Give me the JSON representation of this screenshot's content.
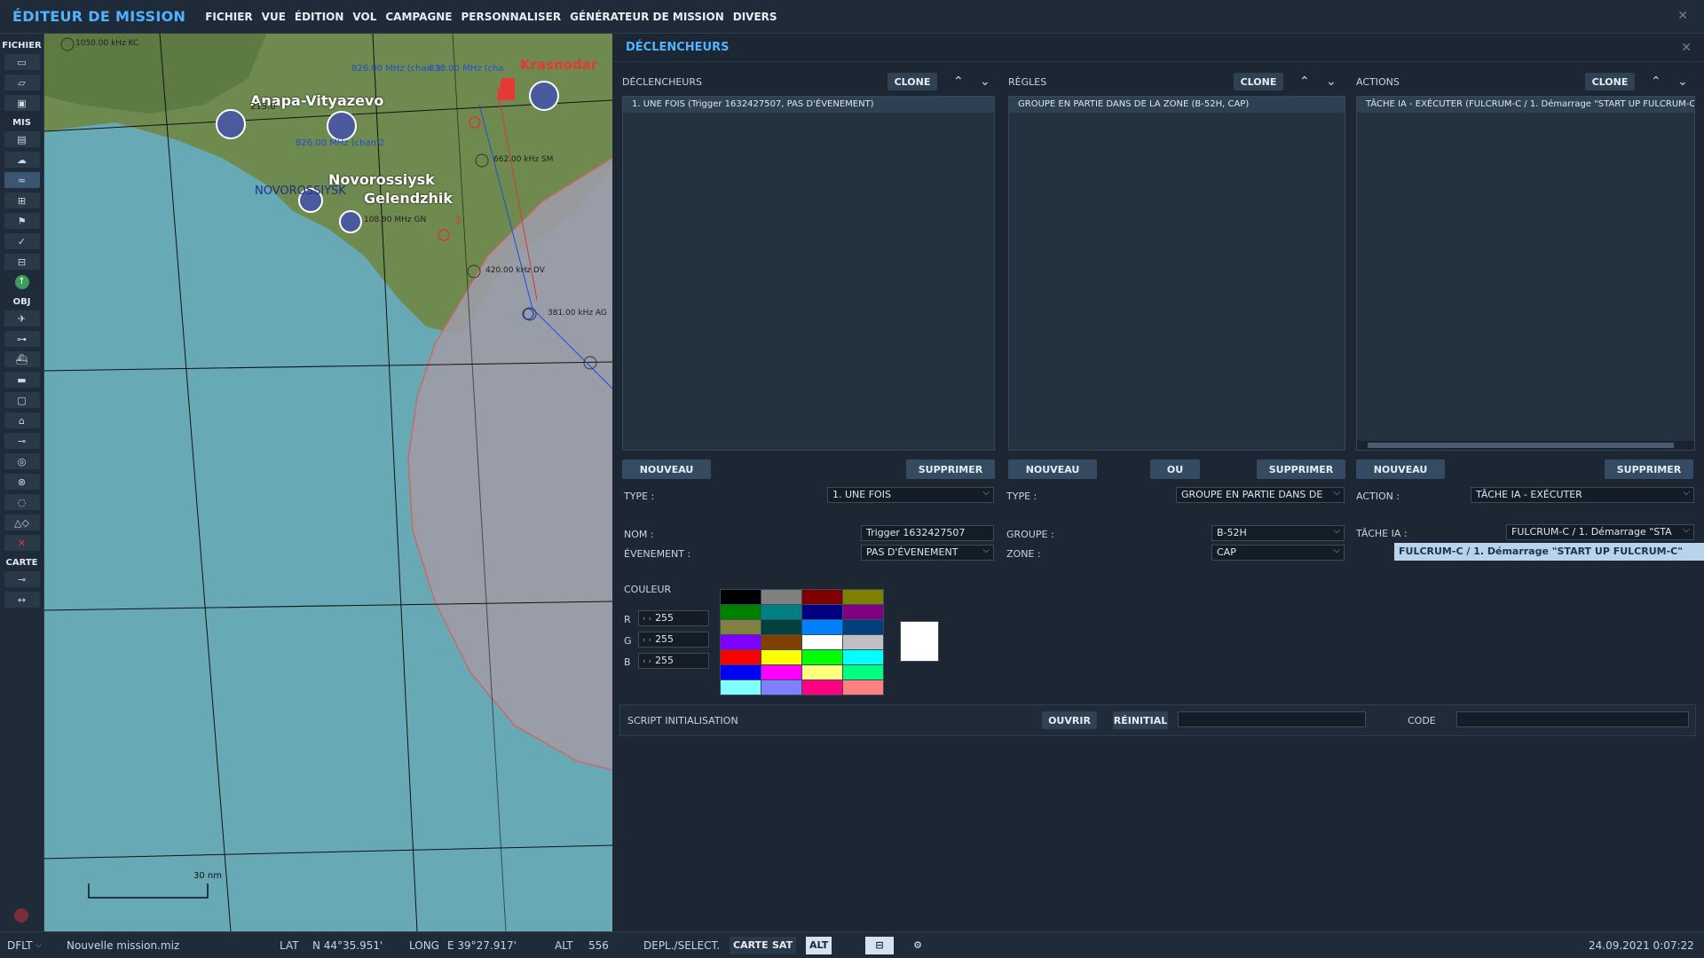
{
  "app": {
    "title": "ÉDITEUR DE MISSION"
  },
  "menu": [
    "FICHIER",
    "VUE",
    "ÉDITION",
    "VOL",
    "CAMPAGNE",
    "PERSONNALISER",
    "GÉNÉRATEUR DE MISSION",
    "DIVERS"
  ],
  "left_toolbar": {
    "fichier": "FICHIER",
    "mis": "MIS",
    "obj": "OBJ",
    "carte": "CARTE"
  },
  "map": {
    "labels": {
      "anapa": "Anapa-Vityazevo",
      "novorossiysk": "Novorossiysk",
      "novorossiysk_upper": "NOVOROSSIYSK",
      "gelendzhik": "Gelendzhik",
      "krasnodar": "Krasnodar"
    },
    "radio": [
      "1050.00 kHz KC",
      "826.00 MHz (chan 3",
      "215.0",
      "838.00 MHz (cha",
      "662.00 kHz SM",
      "420.00 kHz DV",
      "381.00 kHz AG",
      "826.00 MHz (chan 2",
      "108.90 MHz GN",
      "3"
    ],
    "scale": "30 nm"
  },
  "panel": {
    "title": "DÉCLENCHEURS",
    "triggers": {
      "title": "DÉCLENCHEURS",
      "clone": "CLONE",
      "items": [
        "1. UNE FOIS (Trigger 1632427507, PAS D'ÉVENEMENT)"
      ],
      "new": "NOUVEAU",
      "delete": "SUPPRIMER",
      "type_label": "TYPE :",
      "type_value": "1. UNE FOIS",
      "name_label": "NOM :",
      "name_value": "Trigger 1632427507",
      "event_label": "ÉVENEMENT :",
      "event_value": "PAS D'ÉVENEMENT",
      "color_label": "COULEUR",
      "r_label": "R",
      "r_value": "255",
      "g_label": "G",
      "g_value": "255",
      "b_label": "B",
      "b_value": "255"
    },
    "rules": {
      "title": "RÈGLES",
      "clone": "CLONE",
      "items": [
        "GROUPE EN PARTIE DANS DE LA ZONE (B-52H, CAP)"
      ],
      "new": "NOUVEAU",
      "or": "OU",
      "delete": "SUPPRIMER",
      "type_label": "TYPE :",
      "type_value": "GROUPE EN PARTIE DANS DE",
      "group_label": "GROUPE :",
      "group_value": "B-52H",
      "zone_label": "ZONE :",
      "zone_value": "CAP"
    },
    "actions": {
      "title": "ACTIONS",
      "clone": "CLONE",
      "items": [
        "TÂCHE IA - EXÉCUTER (FULCRUM-C / 1. Démarrage \"START UP FULCRUM-C"
      ],
      "new": "NOUVEAU",
      "delete": "SUPPRIMER",
      "action_label": "ACTION :",
      "action_value": "TÂCHE IA - EXÉCUTER",
      "task_label": "TÂCHE IA :",
      "task_value": "FULCRUM-C / 1. Démarrage \"STA",
      "tooltip": "FULCRUM-C / 1. Démarrage \"START UP FULCRUM-C\""
    },
    "script": {
      "label": "SCRIPT INITIALISATION",
      "open": "OUVRIR",
      "reset": "RÉINITIAL",
      "code_label": "CODE"
    },
    "palette": [
      "#000000",
      "#808080",
      "#800000",
      "#808000",
      "#008000",
      "#008080",
      "#000080",
      "#800080",
      "#808040",
      "#004040",
      "#0080ff",
      "#004080",
      "#8000ff",
      "#804000",
      "#ffffff",
      "#c0c0c0",
      "#ff0000",
      "#ffff00",
      "#00ff00",
      "#00ffff",
      "#0000ff",
      "#ff00ff",
      "#ffff80",
      "#00ff80",
      "#80ffff",
      "#8080ff",
      "#ff0080",
      "#ff8080"
    ]
  },
  "status": {
    "profile": "DFLT",
    "file": "Nouvelle mission.miz",
    "lat_label": "LAT",
    "lat": "N 44°35.951'",
    "long_label": "LONG",
    "long": "E 39°27.917'",
    "alt_label": "ALT",
    "alt": "556",
    "mode": "DEPL./SELECT.",
    "carte": "CARTE",
    "sat": "SAT",
    "alt_btn": "ALT",
    "datetime": "24.09.2021 0:07:22"
  },
  "colors": {
    "accent": "#4fb3ff",
    "panel_bg": "#1c2733",
    "sea": "#67a9b5",
    "land": "#6f8a4e"
  }
}
